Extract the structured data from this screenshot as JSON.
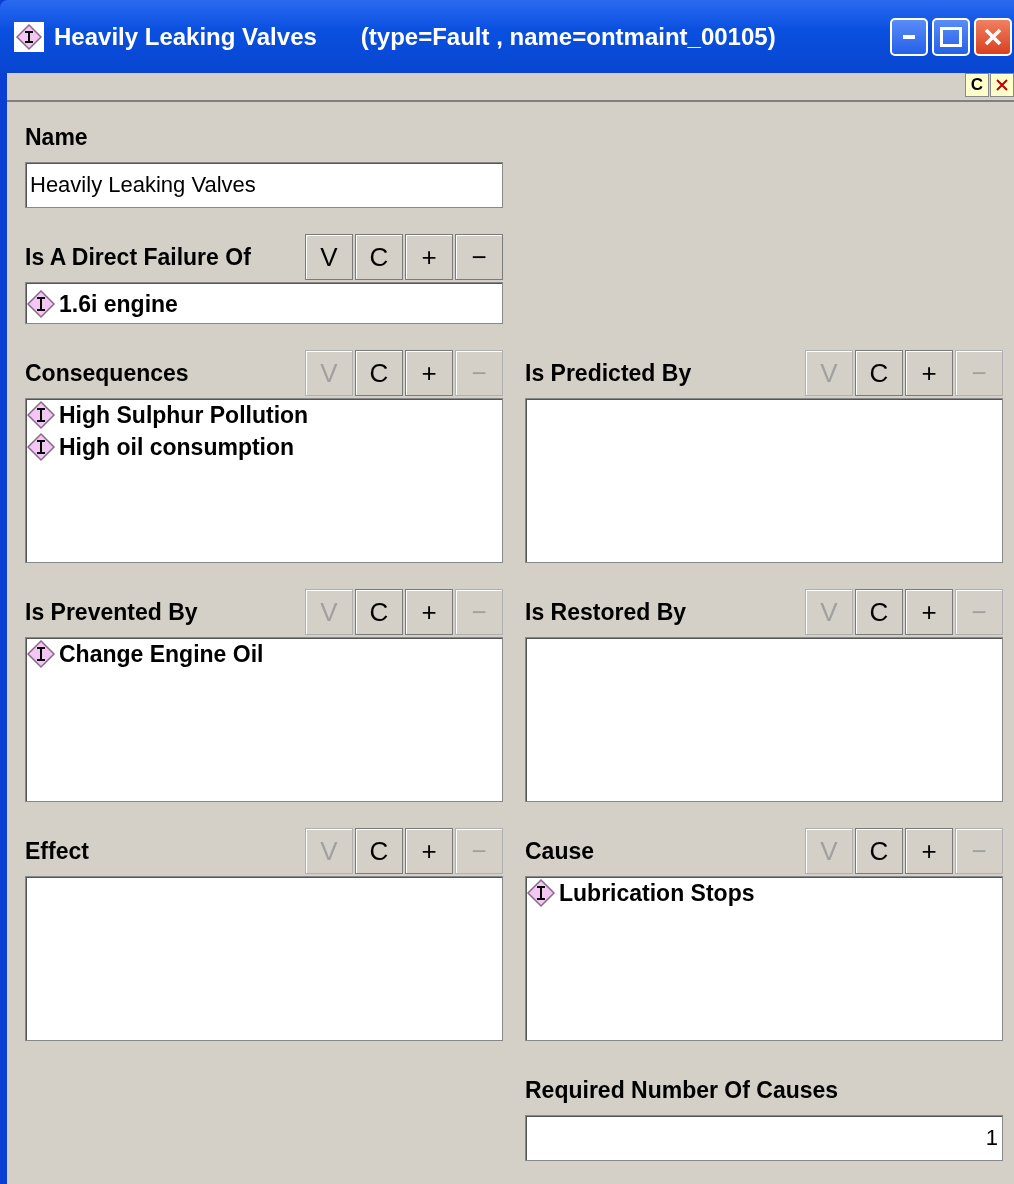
{
  "window": {
    "title": "Heavily Leaking Valves",
    "subtitle": "(type=Fault , name=ontmaint_00105)"
  },
  "toolbar": {
    "buttons": [
      {
        "kind": "text",
        "text": "C"
      },
      {
        "kind": "close"
      }
    ]
  },
  "name_field": {
    "label": "Name",
    "value": "Heavily Leaking Valves"
  },
  "direct_failure": {
    "label": "Is A Direct Failure Of",
    "buttons": [
      {
        "text": "V",
        "disabled": false
      },
      {
        "text": "C",
        "disabled": false
      },
      {
        "text": "+",
        "disabled": false
      },
      {
        "text": "−",
        "disabled": false
      }
    ],
    "items": [
      "1.6i engine"
    ]
  },
  "relations": [
    {
      "label": "Consequences",
      "buttons": [
        {
          "text": "V",
          "disabled": true
        },
        {
          "text": "C",
          "disabled": false
        },
        {
          "text": "+",
          "disabled": false
        },
        {
          "text": "−",
          "disabled": true
        }
      ],
      "items": [
        "High Sulphur Pollution",
        "High oil consumption"
      ]
    },
    {
      "label": "Is Predicted By",
      "buttons": [
        {
          "text": "V",
          "disabled": true
        },
        {
          "text": "C",
          "disabled": false
        },
        {
          "text": "+",
          "disabled": false
        },
        {
          "text": "−",
          "disabled": true
        }
      ]
    },
    {
      "label": "Is Prevented By",
      "buttons": [
        {
          "text": "V",
          "disabled": true
        },
        {
          "text": "C",
          "disabled": false
        },
        {
          "text": "+",
          "disabled": false
        },
        {
          "text": "−",
          "disabled": true
        }
      ],
      "items": [
        "Change Engine Oil"
      ]
    },
    {
      "label": "Is Restored By",
      "buttons": [
        {
          "text": "V",
          "disabled": true
        },
        {
          "text": "C",
          "disabled": false
        },
        {
          "text": "+",
          "disabled": false
        },
        {
          "text": "−",
          "disabled": true
        }
      ]
    },
    {
      "label": "Effect",
      "buttons": [
        {
          "text": "V",
          "disabled": true
        },
        {
          "text": "C",
          "disabled": false
        },
        {
          "text": "+",
          "disabled": false
        },
        {
          "text": "−",
          "disabled": true
        }
      ]
    },
    {
      "label": "Cause",
      "buttons": [
        {
          "text": "V",
          "disabled": true
        },
        {
          "text": "C",
          "disabled": false
        },
        {
          "text": "+",
          "disabled": false
        },
        {
          "text": "−",
          "disabled": true
        }
      ],
      "items": [
        "Lubrication Stops"
      ]
    }
  ],
  "required_causes": {
    "label": "Required Number Of Causes",
    "value": "1"
  }
}
